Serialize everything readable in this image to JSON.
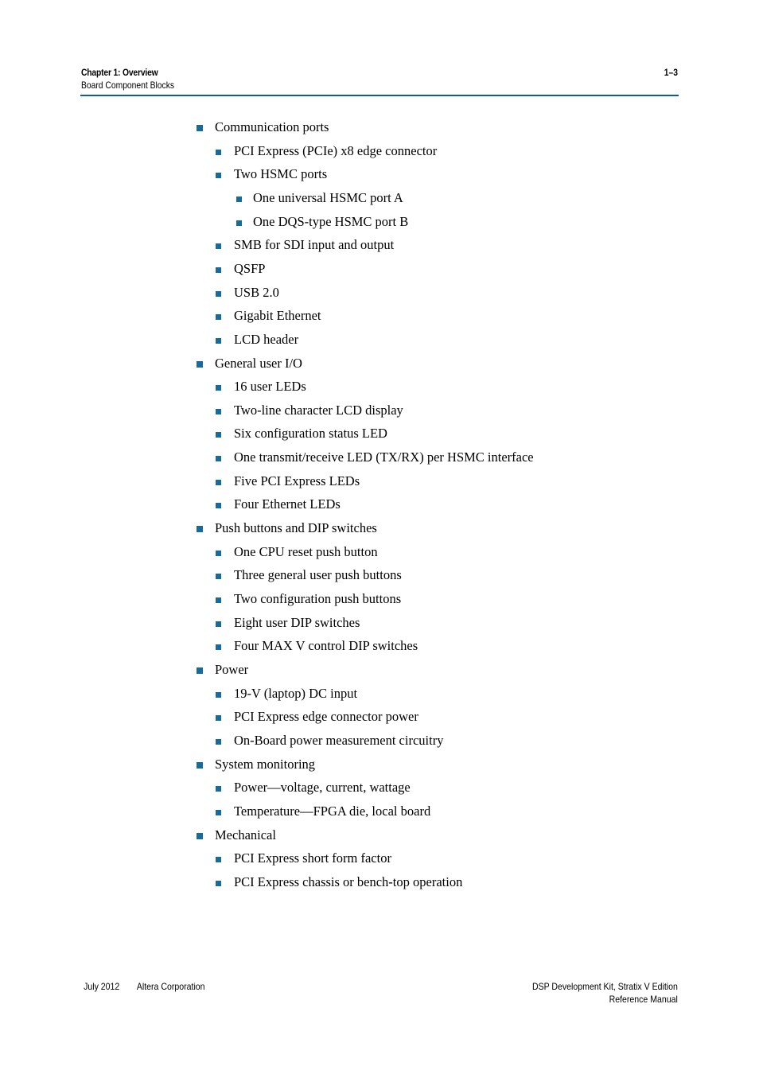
{
  "header": {
    "chapter": "Chapter 1:  Overview",
    "section": "Board Component Blocks",
    "page_number": "1–3"
  },
  "list": [
    {
      "level": 1,
      "text": "Communication ports"
    },
    {
      "level": 2,
      "text": "PCI Express (PCIe) x8 edge connector"
    },
    {
      "level": 2,
      "text": "Two HSMC ports"
    },
    {
      "level": 3,
      "text": "One universal HSMC port A"
    },
    {
      "level": 3,
      "text": "One DQS-type HSMC port B"
    },
    {
      "level": 2,
      "text": "SMB for SDI input and output"
    },
    {
      "level": 2,
      "text": "QSFP"
    },
    {
      "level": 2,
      "text": "USB 2.0"
    },
    {
      "level": 2,
      "text": "Gigabit Ethernet"
    },
    {
      "level": 2,
      "text": "LCD header"
    },
    {
      "level": 1,
      "text": "General user I/O"
    },
    {
      "level": 2,
      "text": "16 user LEDs"
    },
    {
      "level": 2,
      "text": "Two-line character LCD display"
    },
    {
      "level": 2,
      "text": "Six configuration status LED"
    },
    {
      "level": 2,
      "text": "One transmit/receive LED (TX/RX) per HSMC interface"
    },
    {
      "level": 2,
      "text": "Five PCI Express LEDs"
    },
    {
      "level": 2,
      "text": "Four Ethernet LEDs"
    },
    {
      "level": 1,
      "text": "Push buttons and DIP switches"
    },
    {
      "level": 2,
      "text": "One CPU reset push button"
    },
    {
      "level": 2,
      "text": "Three general user push buttons"
    },
    {
      "level": 2,
      "text": "Two configuration push buttons"
    },
    {
      "level": 2,
      "text": "Eight user DIP switches"
    },
    {
      "level": 2,
      "text": "Four MAX V control DIP switches"
    },
    {
      "level": 1,
      "text": "Power"
    },
    {
      "level": 2,
      "text": "19-V (laptop) DC input"
    },
    {
      "level": 2,
      "text": "PCI Express edge connector power"
    },
    {
      "level": 2,
      "text": "On-Board power measurement circuitry"
    },
    {
      "level": 1,
      "text": "System monitoring"
    },
    {
      "level": 2,
      "text": "Power—voltage, current, wattage"
    },
    {
      "level": 2,
      "text": "Temperature—FPGA die, local board"
    },
    {
      "level": 1,
      "text": "Mechanical"
    },
    {
      "level": 2,
      "text": "PCI Express short form factor"
    },
    {
      "level": 2,
      "text": "PCI Express chassis or bench-top operation"
    }
  ],
  "footer": {
    "date": "July 2012",
    "company": "Altera Corporation",
    "title": "DSP Development Kit, Stratix V Edition",
    "subtitle": "Reference Manual"
  },
  "colors": {
    "accent": "#176a9c",
    "rule": "#0d5f8f"
  }
}
